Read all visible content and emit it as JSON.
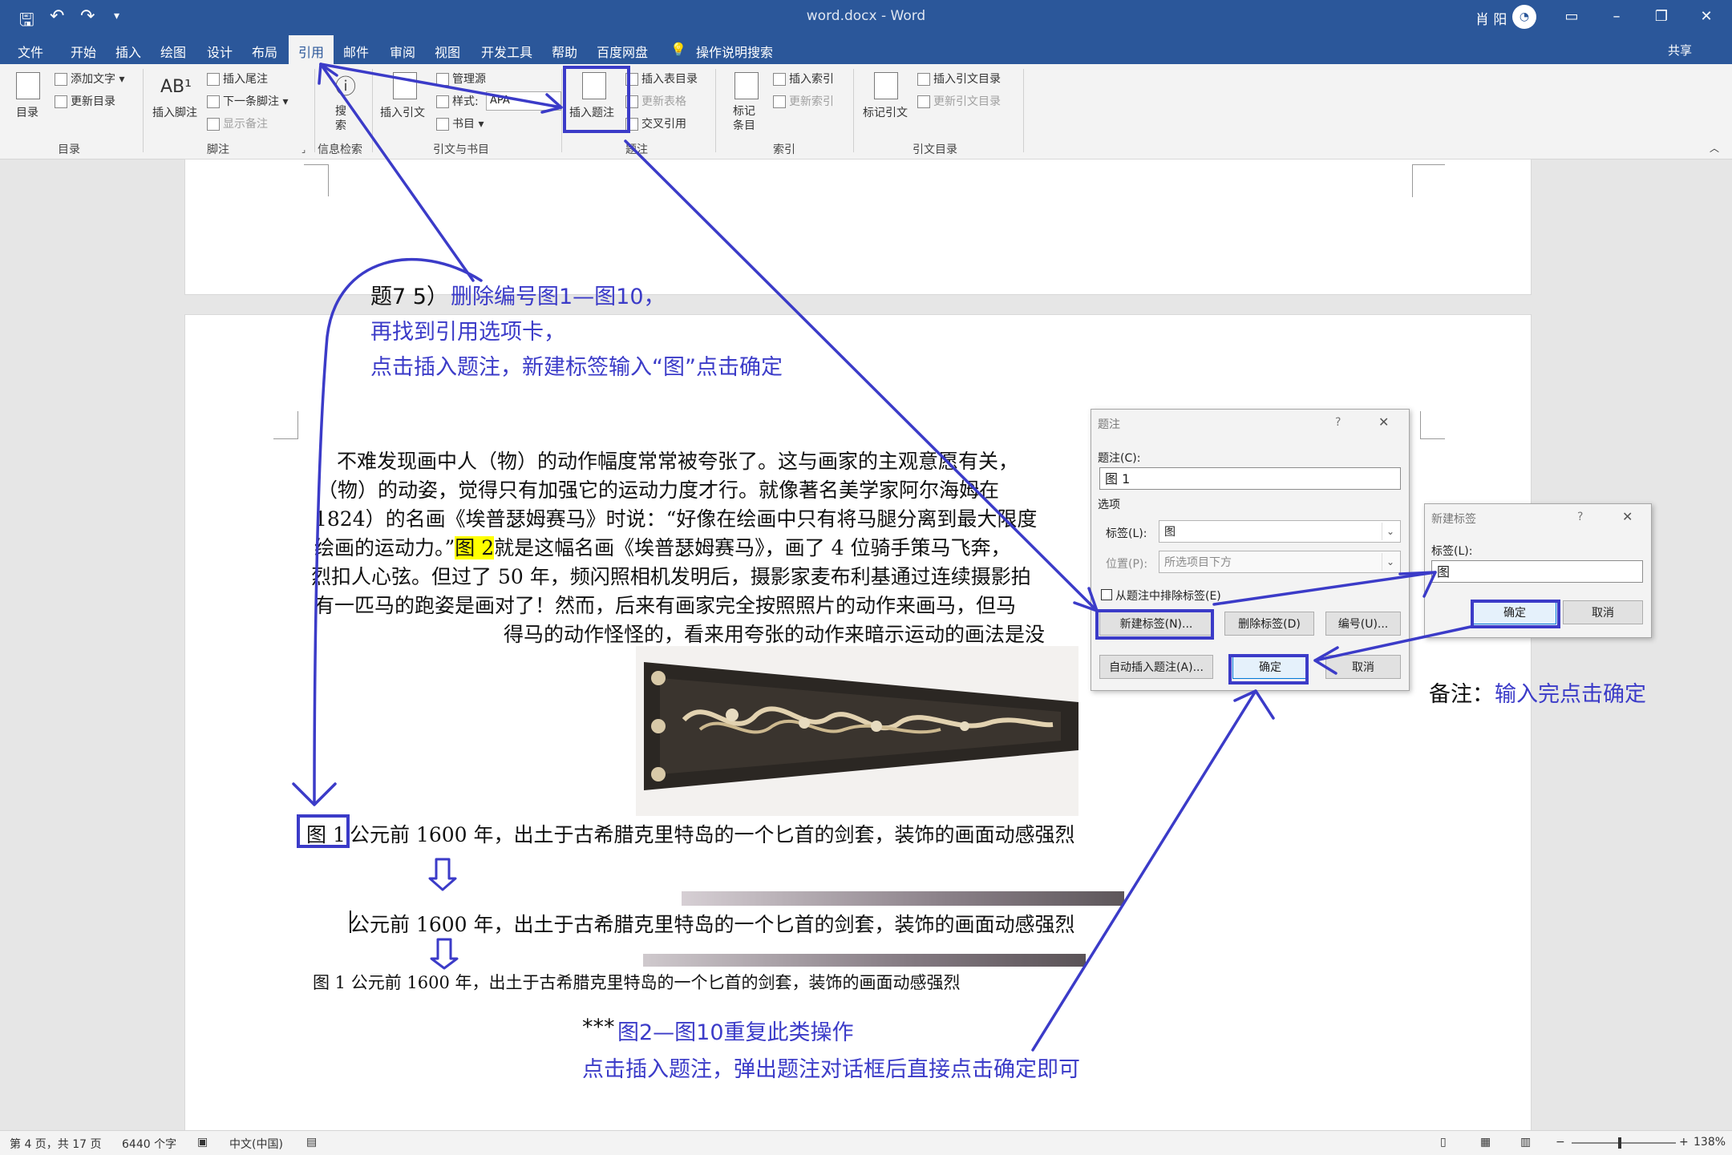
{
  "window": {
    "title": "word.docx - Word",
    "user": "肖 阳",
    "share": "共享"
  },
  "menu": {
    "tabs": [
      "文件",
      "开始",
      "插入",
      "绘图",
      "设计",
      "布局",
      "引用",
      "邮件",
      "审阅",
      "视图",
      "开发工具",
      "帮助",
      "百度网盘"
    ],
    "active_tab": "引用",
    "tell_me": "操作说明搜索"
  },
  "ribbon": {
    "toc": {
      "add_text": "添加文字",
      "update_toc": "更新目录",
      "toc_button": "目录",
      "group": "目录"
    },
    "footnote": {
      "insert_footnote": "插入脚注",
      "insert_endnote": "插入尾注",
      "next_footnote": "下一条脚注",
      "show_notes": "显示备注",
      "group": "脚注"
    },
    "research": {
      "search": "搜索",
      "group": "信息检索"
    },
    "citations": {
      "insert_citation": "插入引文",
      "manage_sources": "管理源",
      "style_label": "样式:",
      "style_value": "APA",
      "bibliography": "书目",
      "group": "引文与书目"
    },
    "captions": {
      "insert_caption": "插入题注",
      "insert_table_of_figures": "插入表目录",
      "update_table": "更新表格",
      "cross_reference": "交叉引用",
      "group": "题注"
    },
    "index": {
      "mark_entry": "标记条目",
      "insert_index": "插入索引",
      "update_index": "更新索引",
      "group": "索引"
    },
    "authorities": {
      "mark_citation": "标记引文",
      "insert_toa": "插入引文目录",
      "update_toa": "更新引文目录",
      "group": "引文目录"
    }
  },
  "document": {
    "paragraph_lines": [
      "不难发现画中人（物）的动作幅度常常被夸张了。这与画家的主观意愿有关，",
      "（物）的动姿，觉得只有加强它的运动力度才行。就像著名美学家阿尔海姆在",
      "1824）的名画《埃普瑟姆赛马》时说：“好像在绘画中只有将马腿分离到最大限度",
      "绘画的运动力。”",
      "图 2",
      "就是这幅名画《埃普瑟姆赛马》，画了 4 位骑手策马飞奔，",
      "烈扣人心弦。但过了 50 年，频闪照相机发明后，摄影家麦布利基通过连续摄影拍",
      "有一匹马的跑姿是画对了！然而，后来有画家完全按照照片的动作来画马，但马",
      "得马的动作怪怪的，看来用夸张的动作来暗示运动的画法是没"
    ],
    "caption1_label": "图 1",
    "caption1_text": "公元前 1600 年，出土于古希腊克里特岛的一个匕首的剑套，装饰的画面动感强烈",
    "caption2_text": "公元前 1600 年，出土于古希腊克里特岛的一个匕首的剑套，装饰的画面动感强烈",
    "caption3_text": "图 1 公元前 1600 年，出土于古希腊克里特岛的一个匕首的剑套，装饰的画面动感强烈"
  },
  "annotations": {
    "q_label": "题7 5）",
    "step1": "删除编号图1—图10，",
    "step2": "再找到引用选项卡，",
    "step3": "点击插入题注，新建标签输入“图”点击确定",
    "note_label": "备注：",
    "note_text": "输入完点击确定",
    "repeat_stars": "***",
    "repeat_line1": "图2—图10重复此类操作",
    "repeat_line2": "点击插入题注，弹出题注对话框后直接点击确定即可"
  },
  "caption_dialog": {
    "title": "题注",
    "help": "?",
    "caption_label": "题注(C):",
    "caption_value": "图 1",
    "options_label": "选项",
    "label_label": "标签(L):",
    "label_value": "图",
    "position_label": "位置(P):",
    "position_value": "所选项目下方",
    "exclude_label": "从题注中排除标签(E)",
    "new_label_btn": "新建标签(N)...",
    "delete_label_btn": "删除标签(D)",
    "numbering_btn": "编号(U)...",
    "autocaption_btn": "自动插入题注(A)...",
    "ok_btn": "确定",
    "cancel_btn": "取消"
  },
  "new_label_dialog": {
    "title": "新建标签",
    "help": "?",
    "label_label": "标签(L):",
    "label_value": "图",
    "ok_btn": "确定",
    "cancel_btn": "取消"
  },
  "statusbar": {
    "page": "第 4 页，共 17 页",
    "words": "6440 个字",
    "language": "中文(中国)",
    "zoom": "138%"
  },
  "colors": {
    "word_blue": "#2b579a",
    "annotation_blue": "#3b3bc8",
    "highlight": "#ffff00"
  }
}
